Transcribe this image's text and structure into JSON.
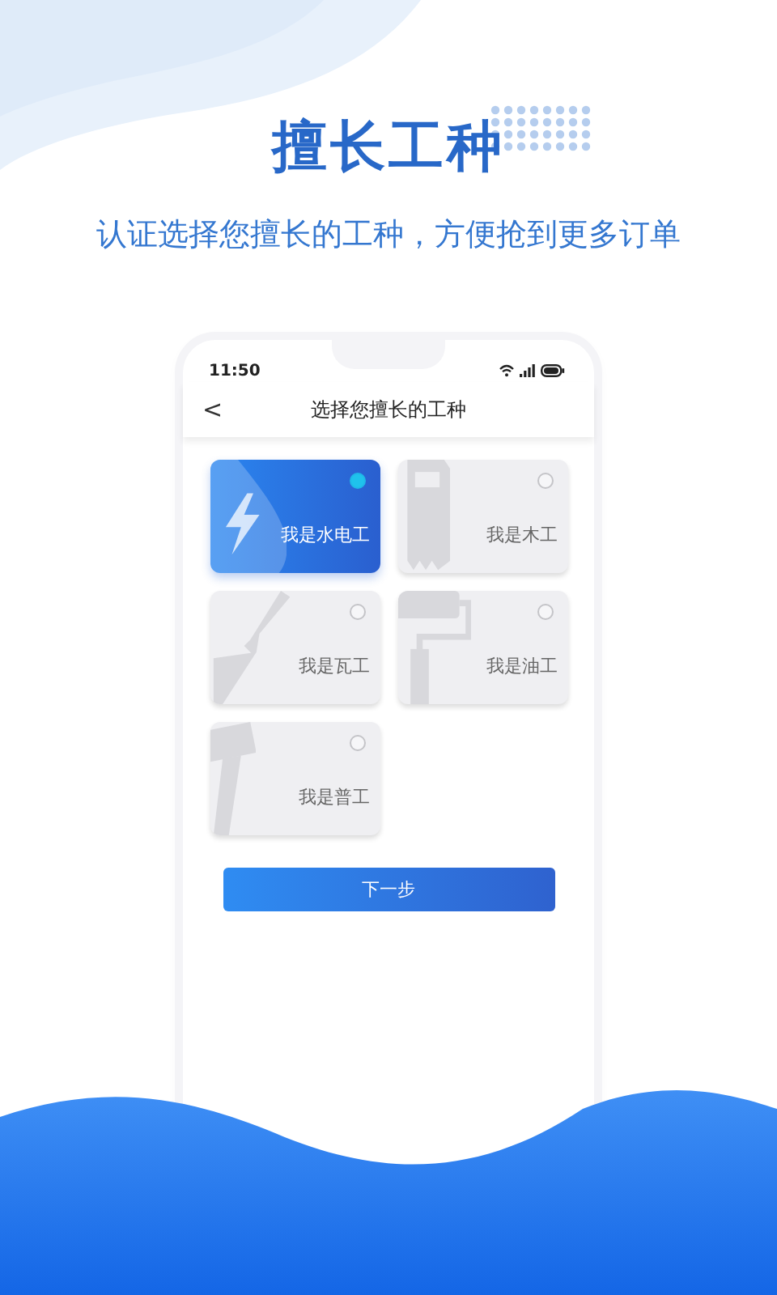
{
  "headline": "擅长工种",
  "subtitle": "认证选择您擅长的工种，方便抢到更多订单",
  "phone": {
    "status_bar": {
      "time": "11:50"
    },
    "nav": {
      "back": "<",
      "title": "选择您擅长的工种"
    },
    "trades": [
      {
        "kind": "electric",
        "label": "我是水电工",
        "selected": true
      },
      {
        "kind": "saw",
        "label": "我是木工",
        "selected": false
      },
      {
        "kind": "trowel",
        "label": "我是瓦工",
        "selected": false
      },
      {
        "kind": "roller",
        "label": "我是油工",
        "selected": false
      },
      {
        "kind": "hammer",
        "label": "我是普工",
        "selected": false
      }
    ],
    "next_button": "下一步"
  }
}
